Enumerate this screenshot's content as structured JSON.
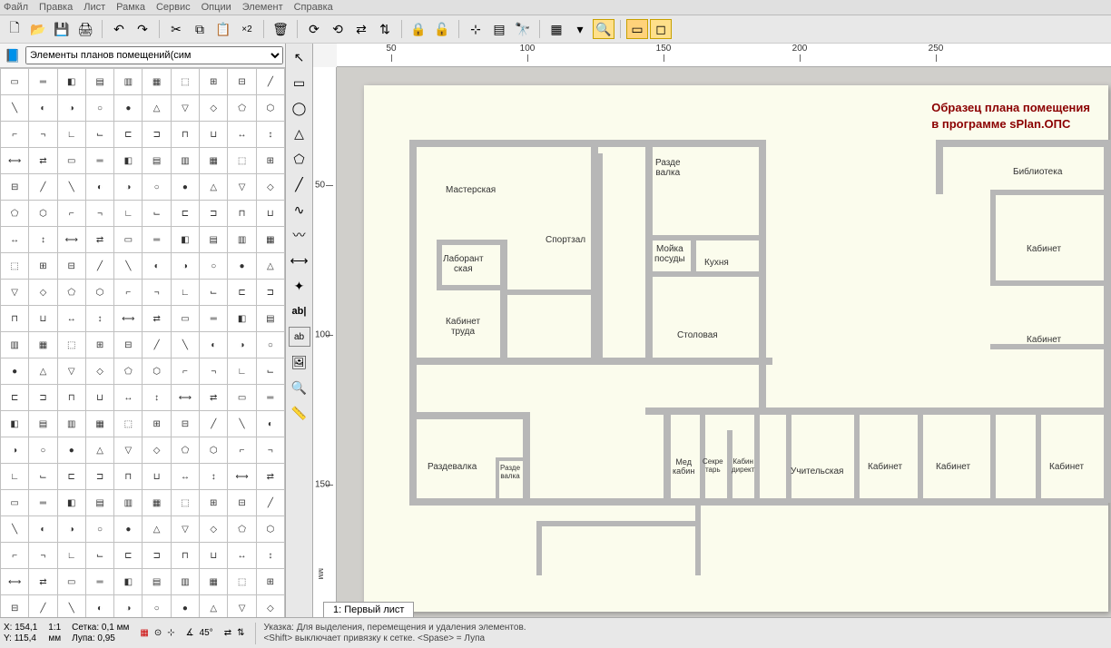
{
  "menu": {
    "items": [
      "Файл",
      "Правка",
      "Лист",
      "Рамка",
      "Сервис",
      "Опции",
      "Элемент",
      "Справка"
    ]
  },
  "library": {
    "dropdown": "Элементы планов помещений(сим"
  },
  "ruler_h": [
    50,
    100,
    150,
    200,
    250
  ],
  "ruler_v": [
    50,
    100,
    150
  ],
  "ruler_v_unit": "мм",
  "plan": {
    "title_l1": "Образец плана помещения",
    "title_l2": "в программе sPlan.ОПС",
    "rooms": {
      "masterskaya": "Мастерская",
      "razdevalka_top": "Разде\nвалка",
      "biblioteka": "Библиотека",
      "laborant": "Лаборант\nская",
      "sportzal": "Спортзал",
      "moyka": "Мойка\nпосуды",
      "kuhnya": "Кухня",
      "kabinet1": "Кабинет",
      "kabinet_truda": "Кабинет\nтруда",
      "stolovaya": "Столовая",
      "kabinet2": "Кабинет",
      "razdevalka": "Раздевалка",
      "razde_valka": "Разде\nвалка",
      "med": "Мед\nкабин",
      "sekretar": "Секре\nтарь",
      "kab_direkt": "Кабин\nдирект",
      "uchitelskaya": "Учительская",
      "kabinet3": "Кабинет",
      "kabinet4": "Кабинет",
      "kabinet5": "Кабинет"
    }
  },
  "sheet_tab": "1: Первый лист",
  "status": {
    "x_lbl": "X:",
    "x_val": "154,1",
    "y_lbl": "Y:",
    "y_val": "115,4",
    "scale": "1:1",
    "scale_unit": "мм",
    "grid_lbl": "Сетка:",
    "grid_val": "0,1 мм",
    "lupa_lbl": "Лупа:",
    "lupa_val": "0,95",
    "angle": "45°",
    "hint_l1": "Указка: Для выделения, перемещения и удаления элементов.",
    "hint_l2": "<Shift> выключает привязку к сетке. <Spase> = Лупа"
  },
  "text_tool": {
    "ab": "ab|",
    "ab2": "ab"
  }
}
